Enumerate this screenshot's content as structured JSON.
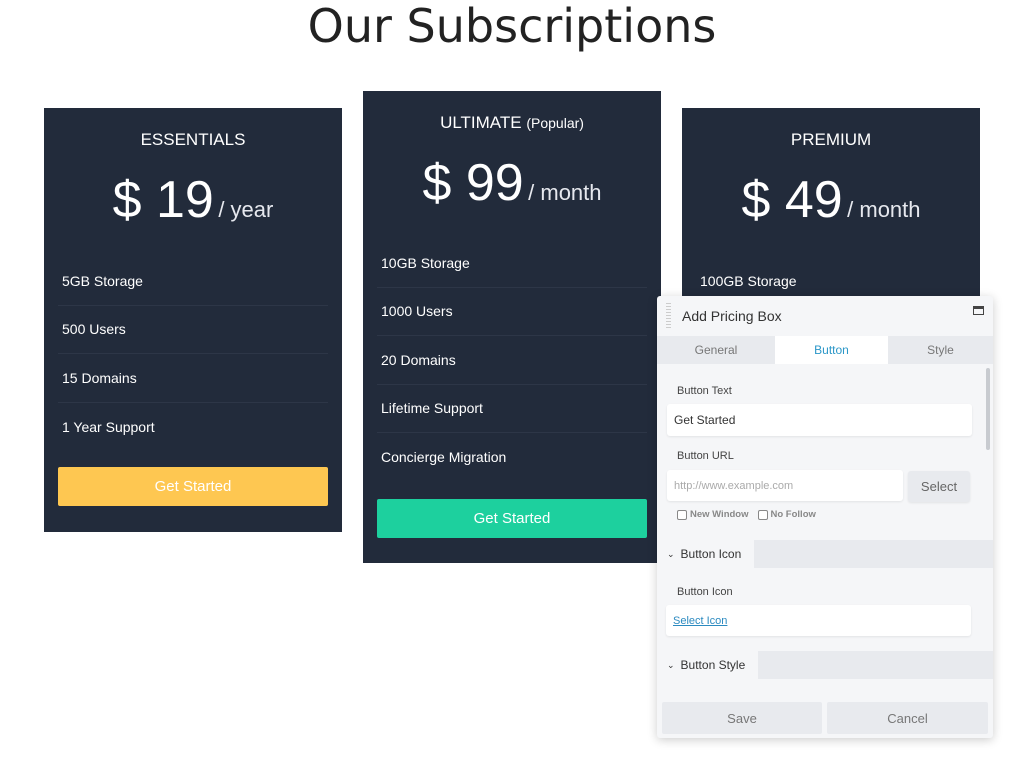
{
  "page_title": "Our Subscriptions",
  "cards": [
    {
      "name": "ESSENTIALS",
      "price": "$ 19",
      "period": "/ year",
      "features": [
        "5GB Storage",
        "500 Users",
        "15 Domains",
        "1 Year Support"
      ],
      "button": "Get Started",
      "button_color": "#fec751"
    },
    {
      "name": "ULTIMATE",
      "tag": "(Popular)",
      "price": "$ 99",
      "period": "/ month",
      "features": [
        "10GB Storage",
        "1000 Users",
        "20 Domains",
        "Lifetime Support",
        "Concierge Migration"
      ],
      "button": "Get Started",
      "button_color": "#1dd09e"
    },
    {
      "name": "PREMIUM",
      "price": "$ 49",
      "period": "/ month",
      "features": [
        "100GB Storage"
      ]
    }
  ],
  "panel": {
    "title": "Add Pricing Box",
    "tabs": [
      "General",
      "Button",
      "Style"
    ],
    "active_tab": "Button",
    "button_text_label": "Button Text",
    "button_text_value": "Get Started",
    "button_url_label": "Button URL",
    "button_url_placeholder": "http://www.example.com",
    "select_label": "Select",
    "new_window": "New Window",
    "no_follow": "No Follow",
    "section_icon": "Button Icon",
    "icon_label": "Button Icon",
    "select_icon": "Select Icon",
    "section_style": "Button Style",
    "save": "Save",
    "cancel": "Cancel"
  }
}
